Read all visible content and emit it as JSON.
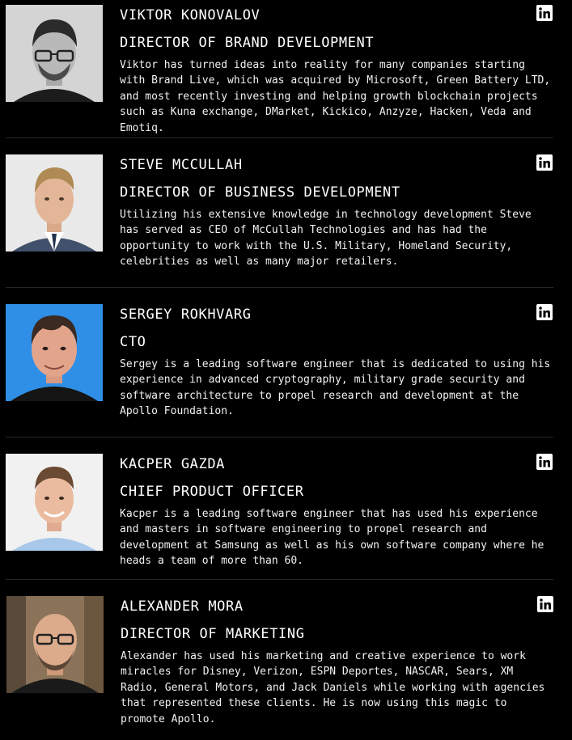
{
  "team": [
    {
      "name": "VIKTOR KONOVALOV",
      "role": "DIRECTOR OF BRAND DEVELOPMENT",
      "bio": "Viktor has turned ideas into reality for many companies starting with Brand Live, which was acquired by Microsoft, Green Battery LTD, and most recently investing and helping growth blockchain projects such as Kuna exchange, DMarket, Kickico, Anzyze, Hacken, Veda and Emotiq.",
      "photo_bg": "#d4d4d4",
      "icon": "linkedin-icon"
    },
    {
      "name": "STEVE MCCULLAH",
      "role": "DIRECTOR OF BUSINESS DEVELOPMENT",
      "bio": "Utilizing his extensive knowledge in technology development Steve has served as CEO of McCullah Technologies and has had the opportunity to work with the U.S. Military, Homeland Security, celebrities as well as many major retailers.",
      "photo_bg": "#e9e9e9",
      "icon": "linkedin-icon"
    },
    {
      "name": "SERGEY ROKHVARG",
      "role": "CTO",
      "bio": "Sergey is a leading software engineer that is dedicated to using his experience in advanced cryptography, military grade security and software architecture to propel research and development at the Apollo Foundation.",
      "photo_bg": "#2f8fe6",
      "icon": "linkedin-icon"
    },
    {
      "name": "KACPER GAZDA",
      "role": "CHIEF PRODUCT OFFICER",
      "bio": "Kacper is a leading software engineer that has used his experience and masters in software engineering to propel research and development at Samsung as well as his own software company where he heads a team of more than 60.",
      "photo_bg": "#f1f1f1",
      "icon": "linkedin-icon"
    },
    {
      "name": "ALEXANDER MORA",
      "role": "DIRECTOR OF MARKETING",
      "bio": "Alexander has used his marketing and creative experience to work miracles for Disney, Verizon, ESPN Deportes, NASCAR, Sears, XM Radio, General Motors, and Jack Daniels while working with agencies that represented these clients. He is now using this magic to promote Apollo.",
      "photo_bg": "#8a7358",
      "icon": "linkedin-icon"
    }
  ]
}
